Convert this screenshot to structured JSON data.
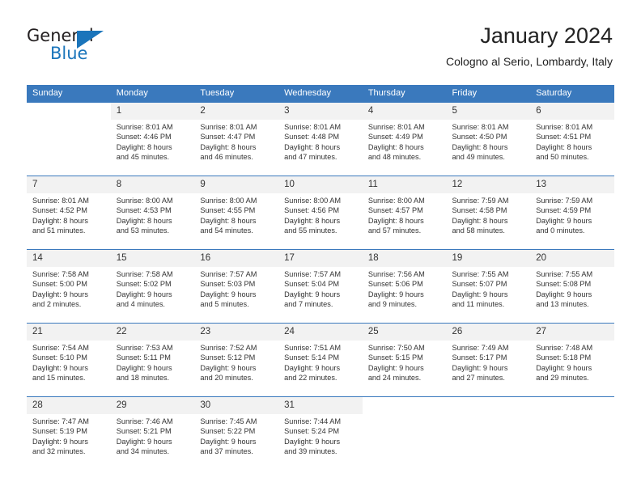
{
  "logo": {
    "word1": "General",
    "word2": "Blue",
    "triangle_color": "#1b75bb"
  },
  "header": {
    "title": "January 2024",
    "subtitle": "Cologno al Serio, Lombardy, Italy"
  },
  "theme": {
    "header_bg": "#3a79bd",
    "daynum_bg": "#f2f2f2",
    "text": "#333333"
  },
  "calendar": {
    "weekday_headers": [
      "Sunday",
      "Monday",
      "Tuesday",
      "Wednesday",
      "Thursday",
      "Friday",
      "Saturday"
    ],
    "weeks": [
      [
        {
          "day": "",
          "sunrise": "",
          "sunset": "",
          "daylight1": "",
          "daylight2": ""
        },
        {
          "day": "1",
          "sunrise": "Sunrise: 8:01 AM",
          "sunset": "Sunset: 4:46 PM",
          "daylight1": "Daylight: 8 hours",
          "daylight2": "and 45 minutes."
        },
        {
          "day": "2",
          "sunrise": "Sunrise: 8:01 AM",
          "sunset": "Sunset: 4:47 PM",
          "daylight1": "Daylight: 8 hours",
          "daylight2": "and 46 minutes."
        },
        {
          "day": "3",
          "sunrise": "Sunrise: 8:01 AM",
          "sunset": "Sunset: 4:48 PM",
          "daylight1": "Daylight: 8 hours",
          "daylight2": "and 47 minutes."
        },
        {
          "day": "4",
          "sunrise": "Sunrise: 8:01 AM",
          "sunset": "Sunset: 4:49 PM",
          "daylight1": "Daylight: 8 hours",
          "daylight2": "and 48 minutes."
        },
        {
          "day": "5",
          "sunrise": "Sunrise: 8:01 AM",
          "sunset": "Sunset: 4:50 PM",
          "daylight1": "Daylight: 8 hours",
          "daylight2": "and 49 minutes."
        },
        {
          "day": "6",
          "sunrise": "Sunrise: 8:01 AM",
          "sunset": "Sunset: 4:51 PM",
          "daylight1": "Daylight: 8 hours",
          "daylight2": "and 50 minutes."
        }
      ],
      [
        {
          "day": "7",
          "sunrise": "Sunrise: 8:01 AM",
          "sunset": "Sunset: 4:52 PM",
          "daylight1": "Daylight: 8 hours",
          "daylight2": "and 51 minutes."
        },
        {
          "day": "8",
          "sunrise": "Sunrise: 8:00 AM",
          "sunset": "Sunset: 4:53 PM",
          "daylight1": "Daylight: 8 hours",
          "daylight2": "and 53 minutes."
        },
        {
          "day": "9",
          "sunrise": "Sunrise: 8:00 AM",
          "sunset": "Sunset: 4:55 PM",
          "daylight1": "Daylight: 8 hours",
          "daylight2": "and 54 minutes."
        },
        {
          "day": "10",
          "sunrise": "Sunrise: 8:00 AM",
          "sunset": "Sunset: 4:56 PM",
          "daylight1": "Daylight: 8 hours",
          "daylight2": "and 55 minutes."
        },
        {
          "day": "11",
          "sunrise": "Sunrise: 8:00 AM",
          "sunset": "Sunset: 4:57 PM",
          "daylight1": "Daylight: 8 hours",
          "daylight2": "and 57 minutes."
        },
        {
          "day": "12",
          "sunrise": "Sunrise: 7:59 AM",
          "sunset": "Sunset: 4:58 PM",
          "daylight1": "Daylight: 8 hours",
          "daylight2": "and 58 minutes."
        },
        {
          "day": "13",
          "sunrise": "Sunrise: 7:59 AM",
          "sunset": "Sunset: 4:59 PM",
          "daylight1": "Daylight: 9 hours",
          "daylight2": "and 0 minutes."
        }
      ],
      [
        {
          "day": "14",
          "sunrise": "Sunrise: 7:58 AM",
          "sunset": "Sunset: 5:00 PM",
          "daylight1": "Daylight: 9 hours",
          "daylight2": "and 2 minutes."
        },
        {
          "day": "15",
          "sunrise": "Sunrise: 7:58 AM",
          "sunset": "Sunset: 5:02 PM",
          "daylight1": "Daylight: 9 hours",
          "daylight2": "and 4 minutes."
        },
        {
          "day": "16",
          "sunrise": "Sunrise: 7:57 AM",
          "sunset": "Sunset: 5:03 PM",
          "daylight1": "Daylight: 9 hours",
          "daylight2": "and 5 minutes."
        },
        {
          "day": "17",
          "sunrise": "Sunrise: 7:57 AM",
          "sunset": "Sunset: 5:04 PM",
          "daylight1": "Daylight: 9 hours",
          "daylight2": "and 7 minutes."
        },
        {
          "day": "18",
          "sunrise": "Sunrise: 7:56 AM",
          "sunset": "Sunset: 5:06 PM",
          "daylight1": "Daylight: 9 hours",
          "daylight2": "and 9 minutes."
        },
        {
          "day": "19",
          "sunrise": "Sunrise: 7:55 AM",
          "sunset": "Sunset: 5:07 PM",
          "daylight1": "Daylight: 9 hours",
          "daylight2": "and 11 minutes."
        },
        {
          "day": "20",
          "sunrise": "Sunrise: 7:55 AM",
          "sunset": "Sunset: 5:08 PM",
          "daylight1": "Daylight: 9 hours",
          "daylight2": "and 13 minutes."
        }
      ],
      [
        {
          "day": "21",
          "sunrise": "Sunrise: 7:54 AM",
          "sunset": "Sunset: 5:10 PM",
          "daylight1": "Daylight: 9 hours",
          "daylight2": "and 15 minutes."
        },
        {
          "day": "22",
          "sunrise": "Sunrise: 7:53 AM",
          "sunset": "Sunset: 5:11 PM",
          "daylight1": "Daylight: 9 hours",
          "daylight2": "and 18 minutes."
        },
        {
          "day": "23",
          "sunrise": "Sunrise: 7:52 AM",
          "sunset": "Sunset: 5:12 PM",
          "daylight1": "Daylight: 9 hours",
          "daylight2": "and 20 minutes."
        },
        {
          "day": "24",
          "sunrise": "Sunrise: 7:51 AM",
          "sunset": "Sunset: 5:14 PM",
          "daylight1": "Daylight: 9 hours",
          "daylight2": "and 22 minutes."
        },
        {
          "day": "25",
          "sunrise": "Sunrise: 7:50 AM",
          "sunset": "Sunset: 5:15 PM",
          "daylight1": "Daylight: 9 hours",
          "daylight2": "and 24 minutes."
        },
        {
          "day": "26",
          "sunrise": "Sunrise: 7:49 AM",
          "sunset": "Sunset: 5:17 PM",
          "daylight1": "Daylight: 9 hours",
          "daylight2": "and 27 minutes."
        },
        {
          "day": "27",
          "sunrise": "Sunrise: 7:48 AM",
          "sunset": "Sunset: 5:18 PM",
          "daylight1": "Daylight: 9 hours",
          "daylight2": "and 29 minutes."
        }
      ],
      [
        {
          "day": "28",
          "sunrise": "Sunrise: 7:47 AM",
          "sunset": "Sunset: 5:19 PM",
          "daylight1": "Daylight: 9 hours",
          "daylight2": "and 32 minutes."
        },
        {
          "day": "29",
          "sunrise": "Sunrise: 7:46 AM",
          "sunset": "Sunset: 5:21 PM",
          "daylight1": "Daylight: 9 hours",
          "daylight2": "and 34 minutes."
        },
        {
          "day": "30",
          "sunrise": "Sunrise: 7:45 AM",
          "sunset": "Sunset: 5:22 PM",
          "daylight1": "Daylight: 9 hours",
          "daylight2": "and 37 minutes."
        },
        {
          "day": "31",
          "sunrise": "Sunrise: 7:44 AM",
          "sunset": "Sunset: 5:24 PM",
          "daylight1": "Daylight: 9 hours",
          "daylight2": "and 39 minutes."
        },
        {
          "day": "",
          "sunrise": "",
          "sunset": "",
          "daylight1": "",
          "daylight2": ""
        },
        {
          "day": "",
          "sunrise": "",
          "sunset": "",
          "daylight1": "",
          "daylight2": ""
        },
        {
          "day": "",
          "sunrise": "",
          "sunset": "",
          "daylight1": "",
          "daylight2": ""
        }
      ]
    ]
  }
}
